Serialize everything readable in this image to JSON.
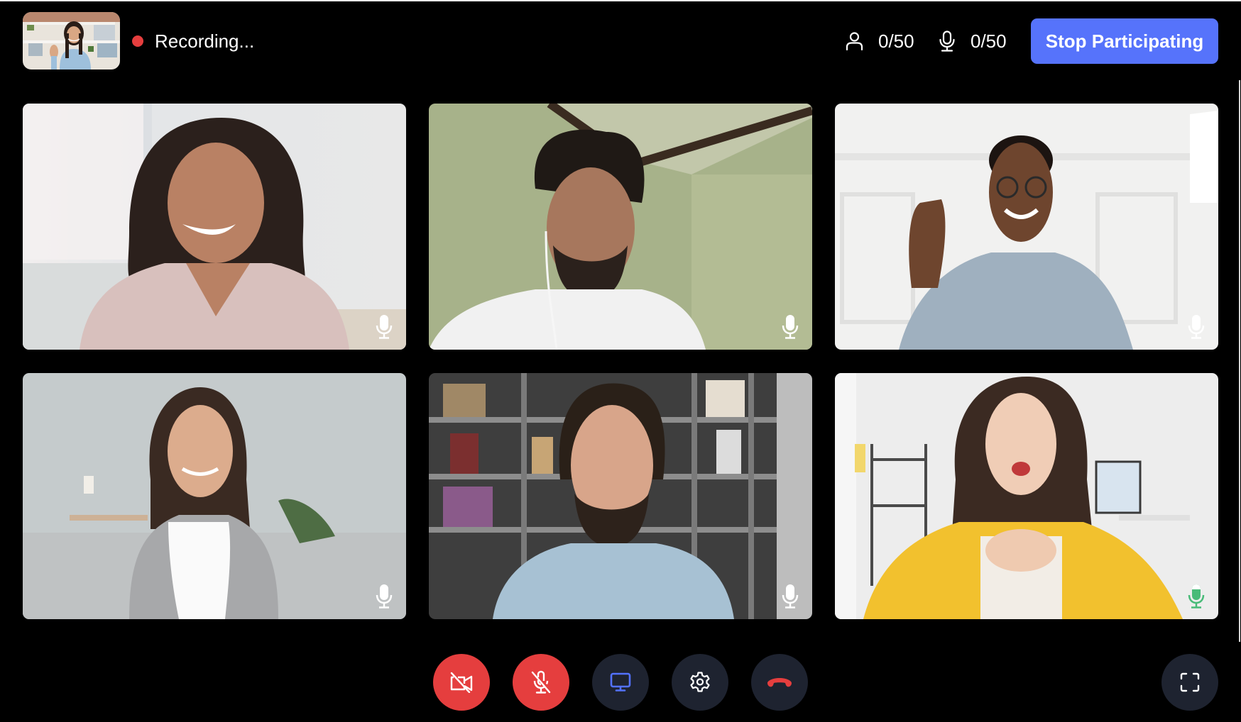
{
  "header": {
    "recording_label": "Recording...",
    "participants_count": "0/50",
    "speakers_count": "0/50",
    "stop_button_label": "Stop Participating",
    "self_view_alt": "Self view"
  },
  "colors": {
    "recording_dot": "#E53E3E",
    "accent": "#5673FB",
    "danger": "#E53E3E",
    "control_dark": "#1E2330",
    "screen_icon": "#5372FF",
    "speaking_green": "#48BB78"
  },
  "participants": [
    {
      "id": "p1",
      "mic_state": "on",
      "speaking": false,
      "alt": "Smiling woman in pink dotted blouse"
    },
    {
      "id": "p2",
      "mic_state": "on",
      "speaking": false,
      "alt": "Man with earphones in white t-shirt"
    },
    {
      "id": "p3",
      "mic_state": "on",
      "speaking": false,
      "alt": "Man with glasses waving"
    },
    {
      "id": "p4",
      "mic_state": "on",
      "speaking": false,
      "alt": "Woman in grey cardigan on sofa"
    },
    {
      "id": "p5",
      "mic_state": "on",
      "speaking": false,
      "alt": "Bearded man in denim shirt before bookshelf"
    },
    {
      "id": "p6",
      "mic_state": "on",
      "speaking": true,
      "alt": "Woman in yellow jacket speaking"
    }
  ],
  "controls": [
    {
      "name": "camera-toggle",
      "icon": "video-off-icon",
      "state": "off"
    },
    {
      "name": "mic-toggle",
      "icon": "mic-off-icon",
      "state": "off"
    },
    {
      "name": "screen-share",
      "icon": "monitor-icon",
      "state": "idle"
    },
    {
      "name": "settings",
      "icon": "gear-icon",
      "state": "idle"
    },
    {
      "name": "hang-up",
      "icon": "phone-hangup-icon",
      "state": "idle"
    },
    {
      "name": "fullscreen",
      "icon": "fullscreen-icon",
      "state": "idle"
    }
  ]
}
